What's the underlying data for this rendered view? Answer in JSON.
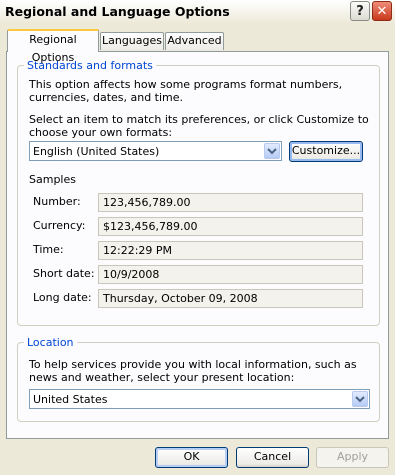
{
  "window": {
    "title": "Regional and Language Options"
  },
  "titlebar": {
    "help_glyph": "?",
    "close_glyph": "✕"
  },
  "tabs": [
    {
      "label": "Regional Options",
      "active": true
    },
    {
      "label": "Languages",
      "active": false
    },
    {
      "label": "Advanced",
      "active": false
    }
  ],
  "standards": {
    "legend": "Standards and formats",
    "description": "This option affects how some programs format numbers, currencies, dates, and time.",
    "instruction": "Select an item to match its preferences, or click Customize to choose your own formats:",
    "format_value": "English (United States)",
    "customize_label": "Customize...",
    "samples_label": "Samples",
    "samples": [
      {
        "label": "Number:",
        "value": "123,456,789.00"
      },
      {
        "label": "Currency:",
        "value": "$123,456,789.00"
      },
      {
        "label": "Time:",
        "value": "12:22:29 PM"
      },
      {
        "label": "Short date:",
        "value": "10/9/2008"
      },
      {
        "label": "Long date:",
        "value": "Thursday, October 09, 2008"
      }
    ]
  },
  "location": {
    "legend": "Location",
    "description": "To help services provide you with local information, such as news and weather, select your present location:",
    "value": "United States"
  },
  "buttons": {
    "ok": "OK",
    "cancel": "Cancel",
    "apply": "Apply"
  },
  "colors": {
    "legend": "#0046d5",
    "tab_highlight": "#ffc83c",
    "close": "#c9391c"
  }
}
